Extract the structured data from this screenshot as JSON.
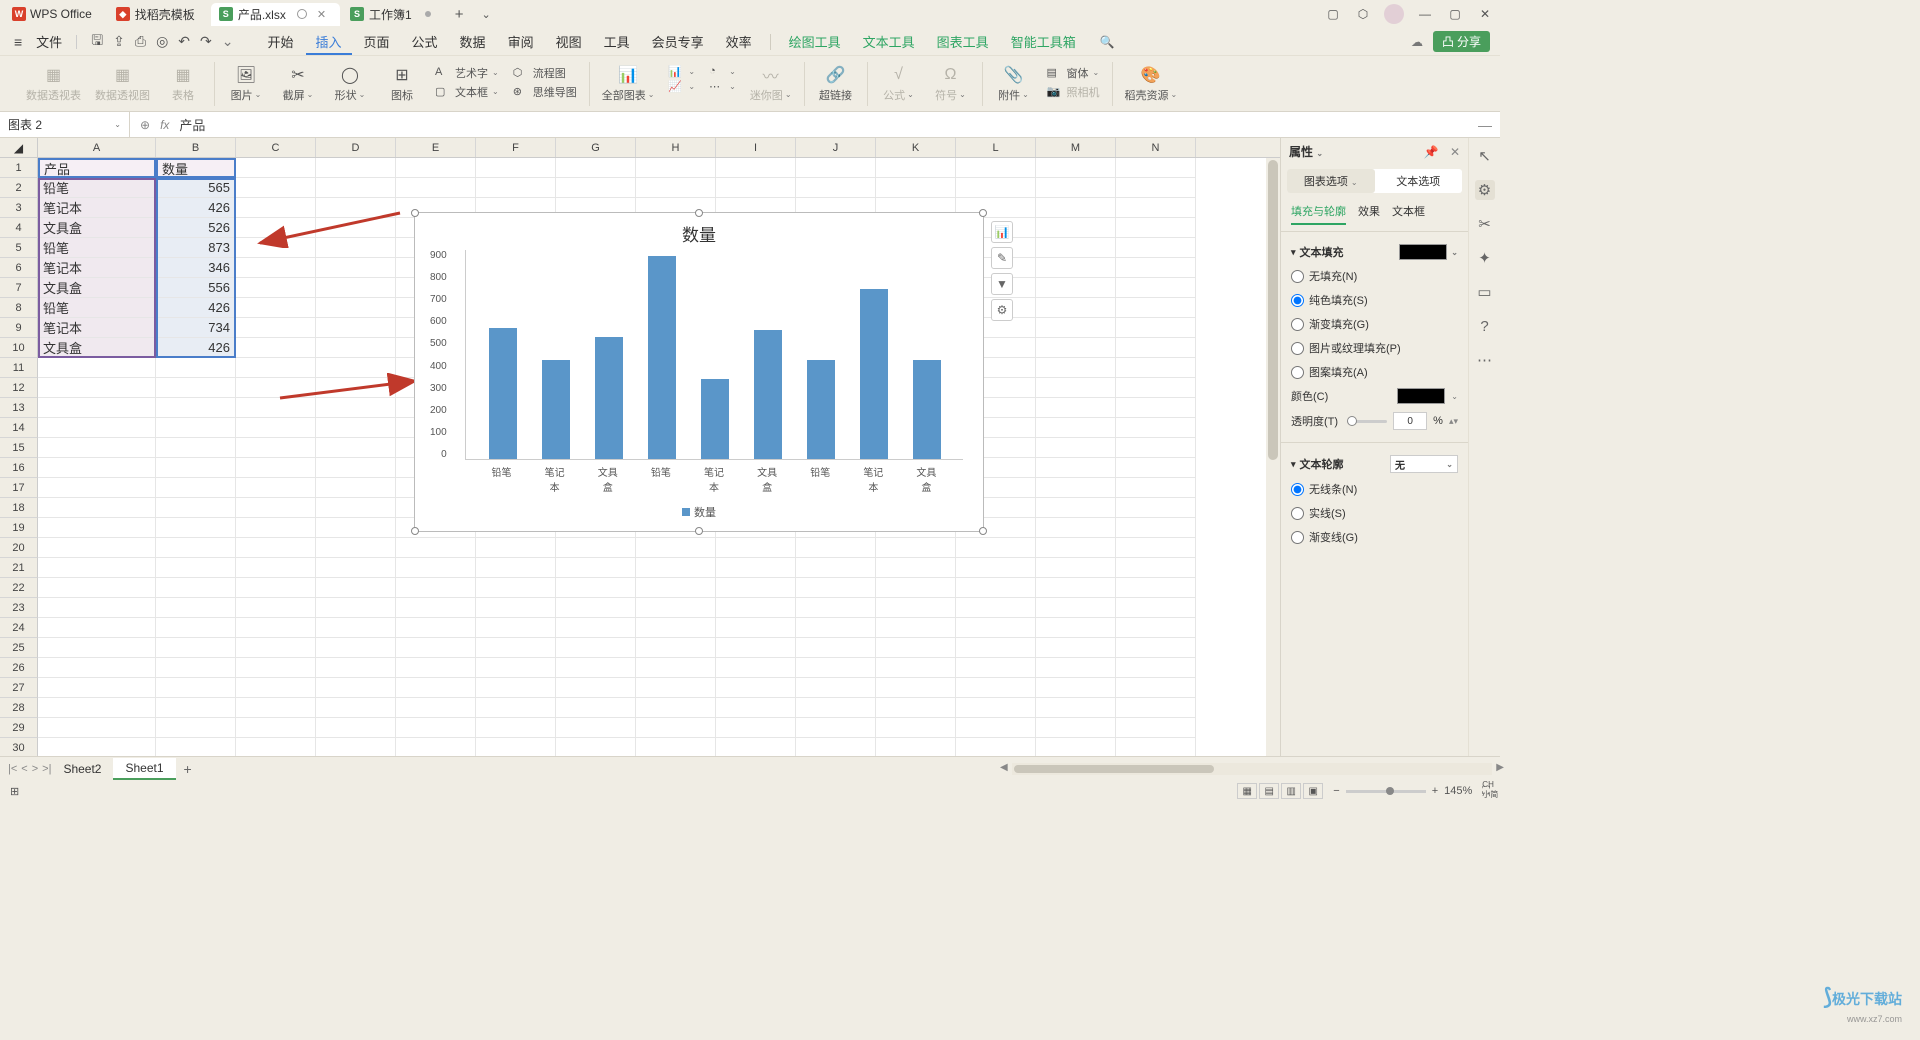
{
  "app": {
    "name": "WPS Office"
  },
  "tabs": [
    {
      "icon": "red",
      "label": "找稻壳模板"
    },
    {
      "icon": "green",
      "label": "产品.xlsx",
      "active": true,
      "hasCircle": true
    },
    {
      "icon": "green",
      "label": "工作簿1"
    }
  ],
  "menubar": {
    "file": "文件",
    "items": [
      "开始",
      "插入",
      "页面",
      "公式",
      "数据",
      "审阅",
      "视图",
      "工具",
      "会员专享",
      "效率"
    ],
    "activeItem": "插入",
    "greenItems": [
      "绘图工具",
      "文本工具",
      "图表工具",
      "智能工具箱"
    ]
  },
  "ribbon": {
    "g1": [
      "数据透视表",
      "数据透视图",
      "表格"
    ],
    "g2": {
      "pic": "图片",
      "screenshot": "截屏",
      "shapes": "形状",
      "icons": "图标",
      "art": "艺术字",
      "textbox": "文本框",
      "flowchart": "流程图",
      "mindmap": "思维导图"
    },
    "g3": {
      "allcharts": "全部图表",
      "spark": "迷你图"
    },
    "g4": {
      "hyperlink": "超链接"
    },
    "g5": {
      "formula": "公式",
      "symbol": "符号"
    },
    "g6": {
      "attach": "附件",
      "form": "窗体",
      "camera": "照相机"
    },
    "g7": {
      "resource": "稻壳资源"
    }
  },
  "share": "分享",
  "namebox": "图表 2",
  "formula": "产品",
  "columns": [
    "A",
    "B",
    "C",
    "D",
    "E",
    "F",
    "G",
    "H",
    "I",
    "J",
    "K",
    "L",
    "M",
    "N"
  ],
  "rowCount": 30,
  "table": {
    "headers": [
      "产品",
      "数量"
    ],
    "rows": [
      [
        "铅笔",
        565
      ],
      [
        "笔记本",
        426
      ],
      [
        "文具盒",
        526
      ],
      [
        "铅笔",
        873
      ],
      [
        "笔记本",
        346
      ],
      [
        "文具盒",
        556
      ],
      [
        "铅笔",
        426
      ],
      [
        "笔记本",
        734
      ],
      [
        "文具盒",
        426
      ]
    ]
  },
  "chart_data": {
    "type": "bar",
    "title": "数量",
    "categories": [
      "铅笔",
      "笔记本",
      "文具盒",
      "铅笔",
      "笔记本",
      "文具盒",
      "铅笔",
      "笔记本",
      "文具盒"
    ],
    "values": [
      565,
      426,
      526,
      873,
      346,
      556,
      426,
      734,
      426
    ],
    "legend": "数量",
    "ylim": [
      0,
      900
    ],
    "yticks": [
      0,
      100,
      200,
      300,
      400,
      500,
      600,
      700,
      800,
      900
    ]
  },
  "panel": {
    "title": "属性",
    "tab1": "图表选项",
    "tab2": "文本选项",
    "sub1": "填充与轮廓",
    "sub2": "效果",
    "sub3": "文本框",
    "sec1": "文本填充",
    "fill_opts": {
      "none": "无填充(N)",
      "solid": "纯色填充(S)",
      "grad": "渐变填充(G)",
      "pic": "图片或纹理填充(P)",
      "pattern": "图案填充(A)"
    },
    "color_label": "颜色(C)",
    "opacity_label": "透明度(T)",
    "opacity_val": "0",
    "opacity_unit": "%",
    "sec2": "文本轮廓",
    "outline_sel": "无",
    "outline_opts": {
      "none": "无线条(N)",
      "solid": "实线(S)",
      "grad": "渐变线(G)"
    }
  },
  "sheets": {
    "s1": "Sheet2",
    "s2": "Sheet1"
  },
  "status": {
    "zoom": "145%"
  },
  "watermark": {
    "main": "极光下载站",
    "sub": "www.xz7.com"
  }
}
